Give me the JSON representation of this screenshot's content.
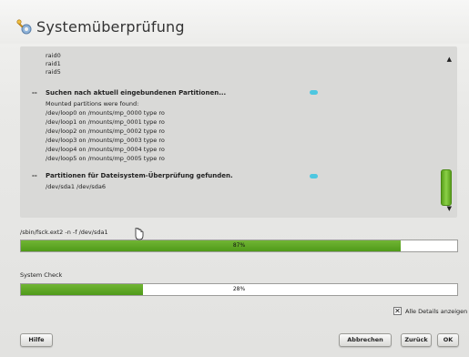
{
  "window": {
    "title": "Systemüberprüfung",
    "icon": "wrench-gear-icon"
  },
  "log": {
    "lines_top": [
      "raid0",
      "raid1",
      "raid5"
    ],
    "section1_heading": "Suchen nach aktuell eingebundenen Partitionen...",
    "section1_lines": [
      "Mounted partitions were found:",
      "/dev/loop0 on /mounts/mp_0000 type ro",
      "/dev/loop1 on /mounts/mp_0001 type ro",
      "/dev/loop2 on /mounts/mp_0002 type ro",
      "/dev/loop3 on /mounts/mp_0003 type ro",
      "/dev/loop4 on /mounts/mp_0004 type ro",
      "/dev/loop5 on /mounts/mp_0005 type ro"
    ],
    "section2_heading": "Partitionen für Dateisystem-Überprüfung gefunden.",
    "section2_lines": [
      "/dev/sda1 /dev/sda6"
    ],
    "bullet": "--"
  },
  "progress_primary": {
    "label": "/sbin/fsck.ext2 -n -f /dev/sda1",
    "percent": 87,
    "percent_text": "87%"
  },
  "progress_secondary": {
    "label": "System Check",
    "percent": 28,
    "percent_text": "28%"
  },
  "details_toggle": {
    "label": "Alle Details anzeigen",
    "checked": true
  },
  "buttons": {
    "help": "Hilfe",
    "cancel": "Abbrechen",
    "back": "Zurück",
    "ok": "OK"
  },
  "colors": {
    "progress": "#5ea525",
    "accent_marker": "#4ec7e0"
  }
}
